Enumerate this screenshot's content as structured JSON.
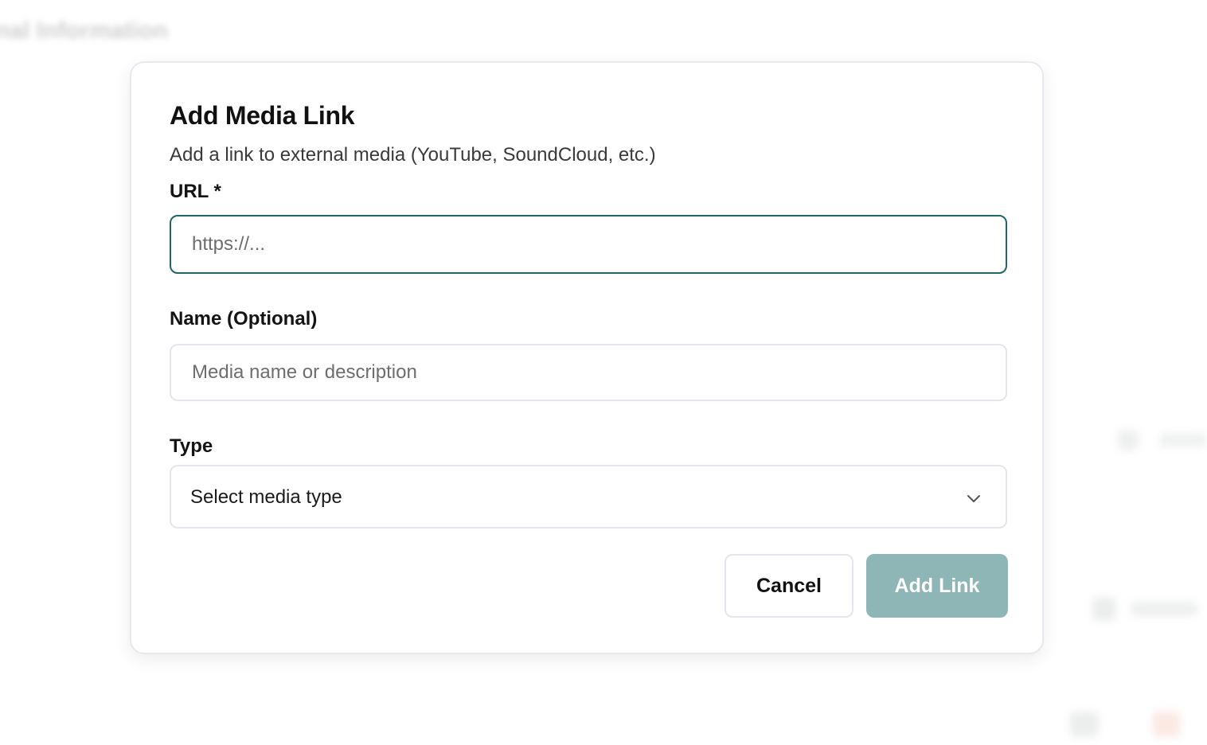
{
  "background": {
    "heading": "nal Information"
  },
  "modal": {
    "title": "Add Media Link",
    "subtitle": "Add a link to external media (YouTube, SoundCloud, etc.)",
    "url": {
      "label": "URL *",
      "value": "",
      "placeholder": "https://..."
    },
    "name": {
      "label": "Name (Optional)",
      "value": "",
      "placeholder": "Media name or description"
    },
    "type": {
      "label": "Type",
      "selected": "Select media type"
    },
    "buttons": {
      "cancel": "Cancel",
      "add": "Add Link"
    },
    "colors": {
      "accent": "#1f6666",
      "primary_disabled": "#8fb6b6",
      "border": "#e3e6ec"
    }
  }
}
